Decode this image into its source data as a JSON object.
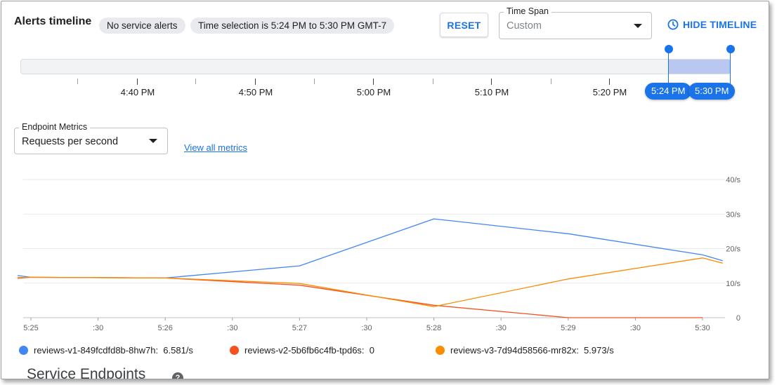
{
  "header": {
    "title": "Alerts timeline",
    "alerts_chip": "No service alerts",
    "selection_chip": "Time selection is 5:24 PM to 5:30 PM GMT-7",
    "reset_label": "RESET",
    "time_span": {
      "label": "Time Span",
      "value": "Custom"
    },
    "hide_timeline_label": "HIDE TIMELINE"
  },
  "timeline": {
    "ticks": [
      "4:40 PM",
      "4:50 PM",
      "5:00 PM",
      "5:10 PM",
      "5:20 PM"
    ],
    "selection_start": "5:24 PM",
    "selection_end": "5:30 PM"
  },
  "metrics": {
    "label": "Endpoint Metrics",
    "value": "Requests per second",
    "view_all_link": "View all metrics"
  },
  "chart_data": {
    "type": "line",
    "x": [
      "5:25",
      ":30",
      "5:26",
      ":30",
      "5:27",
      ":30",
      "5:28",
      ":30",
      "5:29",
      ":30",
      "5:30"
    ],
    "x_minutes": [
      0,
      1,
      2,
      3,
      4,
      5,
      5.3
    ],
    "yticks": [
      "0",
      "10/s",
      "20/s",
      "30/s",
      "40/s"
    ],
    "ylim": [
      0,
      40
    ],
    "grid": true,
    "series": [
      {
        "name": "reviews-v1-849fcdfd8b-8hw7h",
        "color": "#4285f4",
        "current": "6.581/s",
        "points": [
          [
            -0.1,
            12.2
          ],
          [
            0,
            11.7
          ],
          [
            1,
            11.5
          ],
          [
            2,
            15
          ],
          [
            3,
            28.6
          ],
          [
            4,
            24.3
          ],
          [
            5,
            18.2
          ],
          [
            5.15,
            16.5
          ]
        ]
      },
      {
        "name": "reviews-v2-5b6fb6c4fb-tpd6s",
        "color": "#f4511e",
        "current": "0",
        "points": [
          [
            -0.1,
            11.4
          ],
          [
            0,
            11.7
          ],
          [
            1,
            11.5
          ],
          [
            2,
            9.4
          ],
          [
            3,
            3.6
          ],
          [
            4,
            0
          ],
          [
            5,
            0
          ]
        ]
      },
      {
        "name": "reviews-v3-7d94d58566-mr82x",
        "color": "#fb8c00",
        "current": "5.973/s",
        "points": [
          [
            -0.1,
            11.6
          ],
          [
            0,
            11.7
          ],
          [
            1,
            11.5
          ],
          [
            2,
            9.9
          ],
          [
            3,
            3.2
          ],
          [
            4,
            11.2
          ],
          [
            5,
            17.3
          ],
          [
            5.15,
            15.8
          ]
        ]
      }
    ]
  },
  "footer": {
    "section_title": "Service Endpoints",
    "help_icon": "?"
  },
  "icons": {
    "clock": "clock-icon",
    "dropdown": "caret-down-icon",
    "help": "help-icon"
  }
}
